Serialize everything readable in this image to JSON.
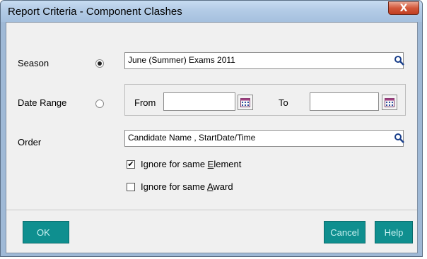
{
  "window": {
    "title": "Report Criteria - Component Clashes",
    "close_glyph": "X"
  },
  "season": {
    "label": "Season",
    "selected": true,
    "value": "June (Summer) Exams 2011"
  },
  "date_range": {
    "label": "Date Range",
    "selected": false,
    "from_label": "From",
    "from_value": "",
    "to_label": "To",
    "to_value": ""
  },
  "order": {
    "label": "Order",
    "value": "Candidate Name , StartDate/Time"
  },
  "options": {
    "ignore_element": {
      "prefix": "Ignore for same ",
      "accel": "E",
      "suffix": "lement",
      "checked": true
    },
    "ignore_award": {
      "prefix": "Ignore for same ",
      "accel": "A",
      "suffix": "ward",
      "checked": false
    }
  },
  "buttons": {
    "ok": "OK",
    "cancel": "Cancel",
    "help": "Help"
  },
  "icons": {
    "lookup": "magnifier-icon",
    "calendar": "calendar-icon"
  },
  "colors": {
    "button_bg": "#0f8f8f",
    "button_text": "#c9f2f2",
    "close_red": "#c8472a"
  }
}
